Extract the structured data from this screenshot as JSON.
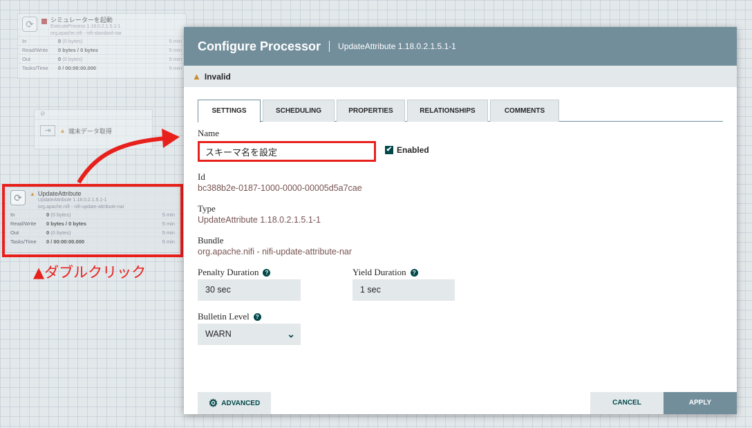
{
  "canvas": {
    "processor_sim": {
      "name": "シミュレーターを起動",
      "type": "ExecuteProcess 1.18.0.2.1.5.1-1",
      "bundle": "org.apache.nifi - nifi-standard-nar",
      "stats": [
        {
          "label": "In",
          "value": "0",
          "extra": "(0 bytes)",
          "time": "5 min"
        },
        {
          "label": "Read/Write",
          "value": "0 bytes / 0 bytes",
          "extra": "",
          "time": "5 min"
        },
        {
          "label": "Out",
          "value": "0",
          "extra": "(0 bytes)",
          "time": "5 min"
        },
        {
          "label": "Tasks/Time",
          "value": "0 / 00:00:00.000",
          "extra": "",
          "time": "5 min"
        }
      ]
    },
    "port_fetch": {
      "name": "端末データ取得"
    },
    "processor_update": {
      "name": "UpdateAttribute",
      "type": "UpdateAttribute 1.18.0.2.1.5.1-1",
      "bundle": "org.apache.nifi - nifi-update-attribute-nar",
      "stats": [
        {
          "label": "In",
          "value": "0",
          "extra": "(0 bytes)",
          "time": "5 min"
        },
        {
          "label": "Read/Write",
          "value": "0 bytes / 0 bytes",
          "extra": "",
          "time": "5 min"
        },
        {
          "label": "Out",
          "value": "0",
          "extra": "(0 bytes)",
          "time": "5 min"
        },
        {
          "label": "Tasks/Time",
          "value": "0 / 00:00:00.000",
          "extra": "",
          "time": "5 min"
        }
      ]
    },
    "annotation": "▲ダブルクリック"
  },
  "dialog": {
    "title": "Configure Processor",
    "subtitle": "UpdateAttribute 1.18.0.2.1.5.1-1",
    "status": "Invalid",
    "tabs": [
      "SETTINGS",
      "SCHEDULING",
      "PROPERTIES",
      "RELATIONSHIPS",
      "COMMENTS"
    ],
    "name_label": "Name",
    "name_value": "スキーマ名を設定",
    "enabled_label": "Enabled",
    "id_label": "Id",
    "id_value": "bc388b2e-0187-1000-0000-00005d5a7cae",
    "type_label": "Type",
    "type_value": "UpdateAttribute 1.18.0.2.1.5.1-1",
    "bundle_label": "Bundle",
    "bundle_value": "org.apache.nifi - nifi-update-attribute-nar",
    "penalty_label": "Penalty Duration",
    "penalty_value": "30 sec",
    "yield_label": "Yield Duration",
    "yield_value": "1 sec",
    "bulletin_label": "Bulletin Level",
    "bulletin_value": "WARN",
    "advanced_label": "ADVANCED",
    "cancel_label": "CANCEL",
    "apply_label": "APPLY"
  },
  "colors": {
    "header": "#728e9b",
    "accent_red": "#e8201c",
    "value_text": "#775351",
    "primary_dark": "#004849"
  }
}
